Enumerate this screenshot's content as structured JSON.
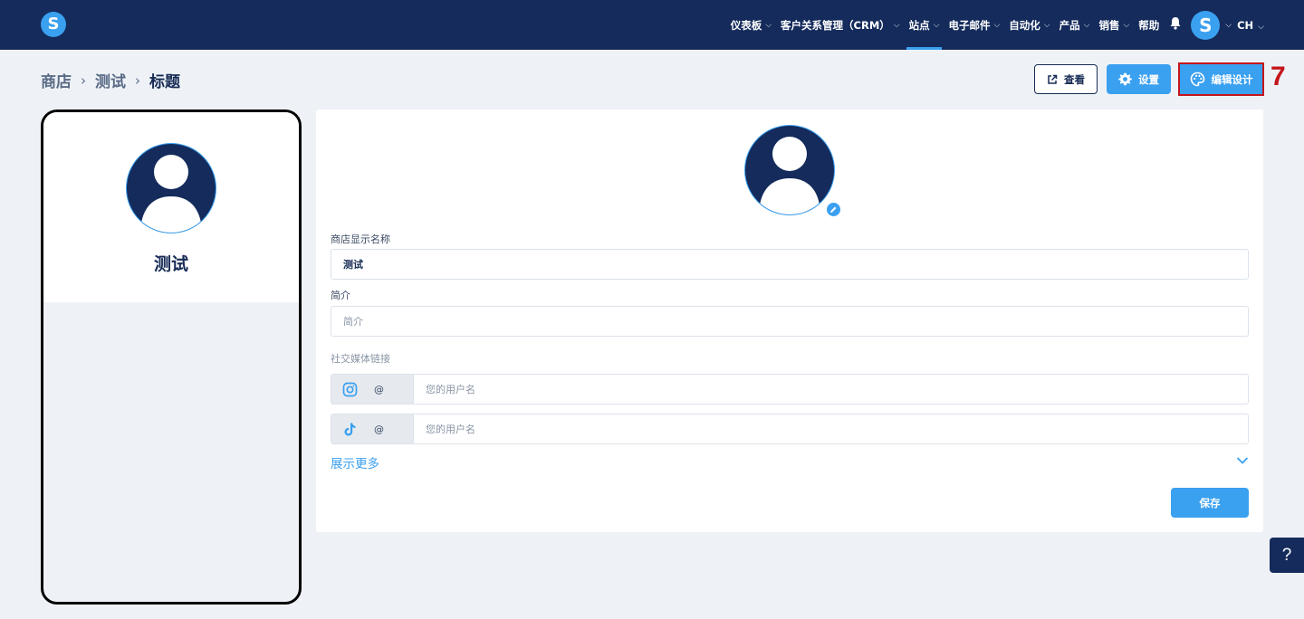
{
  "brand": {
    "logo_letter": "S"
  },
  "nav": {
    "items": [
      {
        "label": "仪表板",
        "dropdown": true
      },
      {
        "label": "客户关系管理（CRM）",
        "dropdown": true
      },
      {
        "label": "站点",
        "dropdown": true,
        "active": true
      },
      {
        "label": "电子邮件",
        "dropdown": true
      },
      {
        "label": "自动化",
        "dropdown": true
      },
      {
        "label": "产品",
        "dropdown": true
      },
      {
        "label": "销售",
        "dropdown": true
      },
      {
        "label": "帮助",
        "dropdown": false
      }
    ],
    "user_initial": "S",
    "language": "CH"
  },
  "breadcrumb": {
    "items": [
      "商店",
      "测试",
      "标题"
    ]
  },
  "actions": {
    "view_label": "查看",
    "settings_label": "设置",
    "design_label": "编辑设计",
    "step_number": "7"
  },
  "preview": {
    "store_name": "测试"
  },
  "form": {
    "display_name_label": "商店显示名称",
    "display_name_value": "测试",
    "bio_label": "简介",
    "bio_placeholder": "简介",
    "social_label": "社交媒体链接",
    "social": [
      {
        "icon": "instagram-icon",
        "prefix": "@",
        "placeholder": "您的用户名"
      },
      {
        "icon": "tiktok-icon",
        "prefix": "@",
        "placeholder": "您的用户名"
      }
    ],
    "show_more_label": "展示更多",
    "save_label": "保存"
  },
  "help": {
    "label": "?"
  },
  "colors": {
    "nav_bg": "#142b5c",
    "accent": "#3aa0f0",
    "highlight": "#c4161c"
  }
}
